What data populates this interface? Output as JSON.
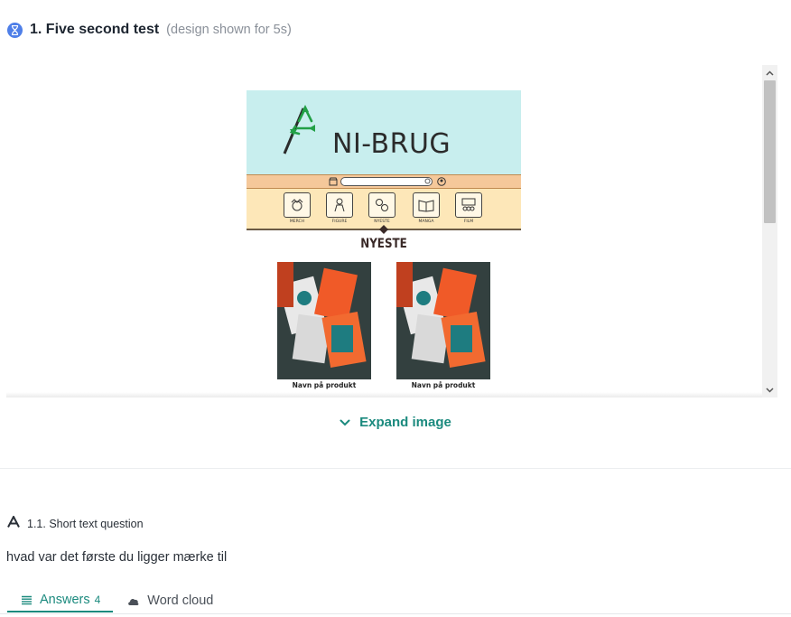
{
  "header": {
    "title": "1. Five second test",
    "subtitle": "(design shown for 5s)",
    "icon": "hourglass-icon"
  },
  "design": {
    "brand": "NI-BRUG",
    "categories": [
      "MERCH",
      "FIGURE",
      "NYESTE",
      "MANGA",
      "FILM"
    ],
    "section_title": "NYESTE",
    "products": [
      "Navn på produkt",
      "Navn på produkt"
    ]
  },
  "expand": {
    "label": "Expand image",
    "icon": "chevron-down-icon"
  },
  "question": {
    "label": "1.1. Short text question",
    "text": "hvad var det første du ligger mærke til",
    "icon": "text-a-icon"
  },
  "tabs": {
    "answers_label": "Answers",
    "answers_count": "4",
    "wordcloud_label": "Word cloud"
  },
  "colors": {
    "accent": "#1b8a7e",
    "timer_icon": "#4f7fe8"
  }
}
